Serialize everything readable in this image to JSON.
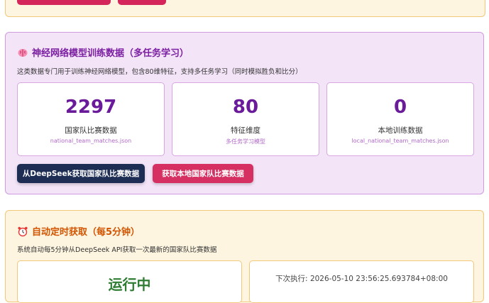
{
  "nn_panel": {
    "title": "神经网络模型训练数据（多任务学习）",
    "icon": "brain-icon",
    "description": "这类数据专门用于训练神经网络模型，包含80维特征，支持多任务学习（同时模拟胜负和比分）",
    "stats": [
      {
        "value": "2297",
        "label": "国家队比赛数据",
        "sub": "national_team_matches.json"
      },
      {
        "value": "80",
        "label": "特征维度",
        "sub": "多任务学习模型"
      },
      {
        "value": "0",
        "label": "本地训练数据",
        "sub": "local_national_team_matches.json"
      }
    ],
    "buttons": {
      "fetch_deepseek": "从DeepSeek获取国家队比赛数据",
      "fetch_local": "获取本地国家队比赛数据"
    }
  },
  "auto_panel": {
    "title": "自动定时获取（每5分钟）",
    "icon": "alarm-clock-icon",
    "description": "系统自动每5分钟从DeepSeek API获取一次最新的国家队比赛数据",
    "status": "运行中",
    "next_run": "下次执行: 2026-05-10 23:56:25.693784+08:00"
  },
  "colors": {
    "purple_accent": "#7b1fa2",
    "orange_accent": "#d35400",
    "running_green": "#2e7d32",
    "red_button": "#d63063",
    "dark_button": "#1d2d54"
  }
}
